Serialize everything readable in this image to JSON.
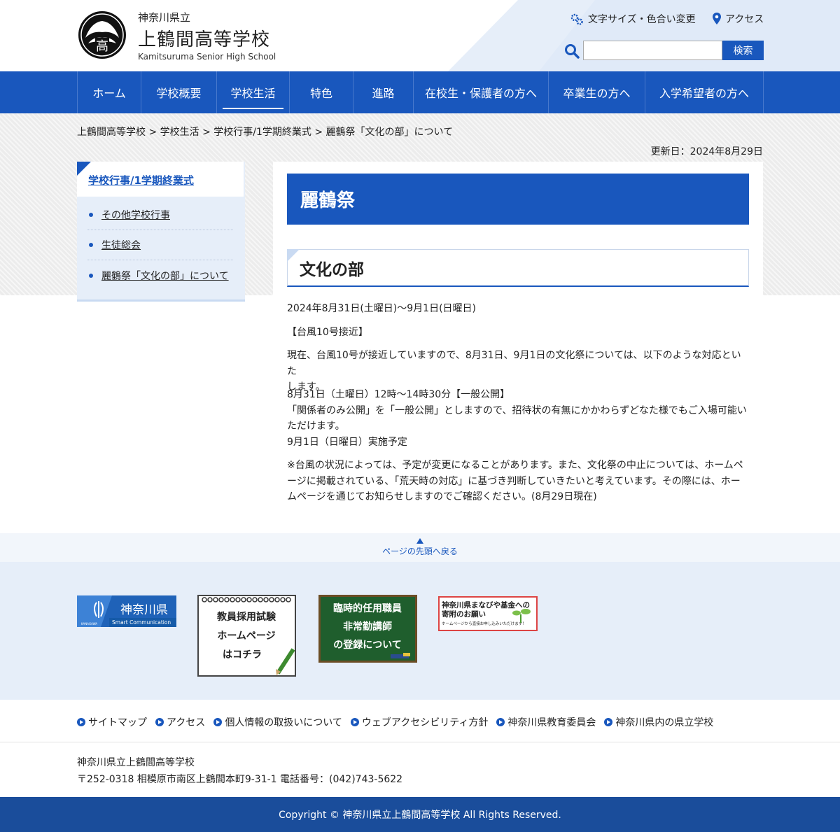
{
  "header": {
    "pref": "神奈川県立",
    "school_name": "上鶴間高等学校",
    "school_en": "Kamitsuruma Senior High School",
    "font_color_link": "文字サイズ・色合い変更",
    "access_link": "アクセス",
    "search_placeholder": "",
    "search_button": "検索"
  },
  "nav": {
    "items": [
      {
        "label": "ホーム"
      },
      {
        "label": "学校概要"
      },
      {
        "label": "学校生活"
      },
      {
        "label": "特色"
      },
      {
        "label": "進路"
      },
      {
        "label": "在校生・保護者の方へ"
      },
      {
        "label": "卒業生の方へ"
      },
      {
        "label": "入学希望者の方へ"
      }
    ],
    "active_index": 2
  },
  "breadcrumb": {
    "items": [
      "上鶴間高等学校",
      "学校生活",
      "学校行事/1学期終業式",
      "麗鶴祭「文化の部」について"
    ],
    "sep": " > "
  },
  "updated": "更新日：2024年8月29日",
  "sidebar": {
    "title": "学校行事/1学期終業式",
    "items": [
      {
        "label": "その他学校行事"
      },
      {
        "label": "生徒総会"
      },
      {
        "label": "麗鶴祭「文化の部」について"
      }
    ]
  },
  "main": {
    "h1": "麗鶴祭",
    "h2": "文化の部",
    "p1": "2024年8月31日(土曜日)～9月1日(日曜日)",
    "p2": "【台風10号接近】",
    "p3a": "現在、台風10号が接近していますので、8月31日、9月1日の文化祭については、以下のような対応といた",
    "p3b": "します。",
    "p4a": "8月31日（土曜日）12時～14時30分【一般公開】",
    "p4b": "「関係者のみ公開」を「一般公開」としますので、招待状の有無にかかわらずどなた様でもご入場可能い",
    "p4c": "ただけます。",
    "p4d": "9月1日（日曜日）実施予定",
    "p5a": "※台風の状況によっては、予定が変更になることがあります。また、文化祭の中止については、ホームペ",
    "p5b": "ージに掲載されている、「荒天時の対応」に基づき判断していきたいと考えています。その際には、ホー",
    "p5c": "ムページを通じてお知らせしますのでご確認ください。(8月29日現在)"
  },
  "pagetop": "ページの先頭へ戻る",
  "banners": {
    "kanagawa_title": "神奈川県",
    "kanagawa_sub": "Smart Communication",
    "kanagawa_small": "KANAGAWA",
    "notebook_l1": "教員採用試験",
    "notebook_l2": "ホームページ",
    "notebook_l3": "はコチラ",
    "board_l1": "臨時的任用職員",
    "board_l2": "非常勤講師",
    "board_l3": "の登録について",
    "fund_l1": "神奈川県まなびや基金への",
    "fund_l2": "寄附のお願い",
    "fund_l3": "ホームページから直接お申し込みいただけます！"
  },
  "footer": {
    "links": [
      {
        "label": "サイトマップ"
      },
      {
        "label": "アクセス"
      },
      {
        "label": "個人情報の取扱いについて"
      },
      {
        "label": "ウェブアクセシビリティ方針"
      },
      {
        "label": "神奈川県教育委員会"
      },
      {
        "label": "神奈川県内の県立学校"
      }
    ],
    "addr1": "神奈川県立上鶴間高等学校",
    "addr2": "〒252-0318 相模原市南区上鶴間本町9-31-1 電話番号：(042)743-5622",
    "copyright": "Copyright © 神奈川県立上鶴間高等学校 All Rights Reserved."
  },
  "colors": {
    "primary": "#1957bd",
    "light": "#e6eef9",
    "footer": "#1a4d9b"
  }
}
